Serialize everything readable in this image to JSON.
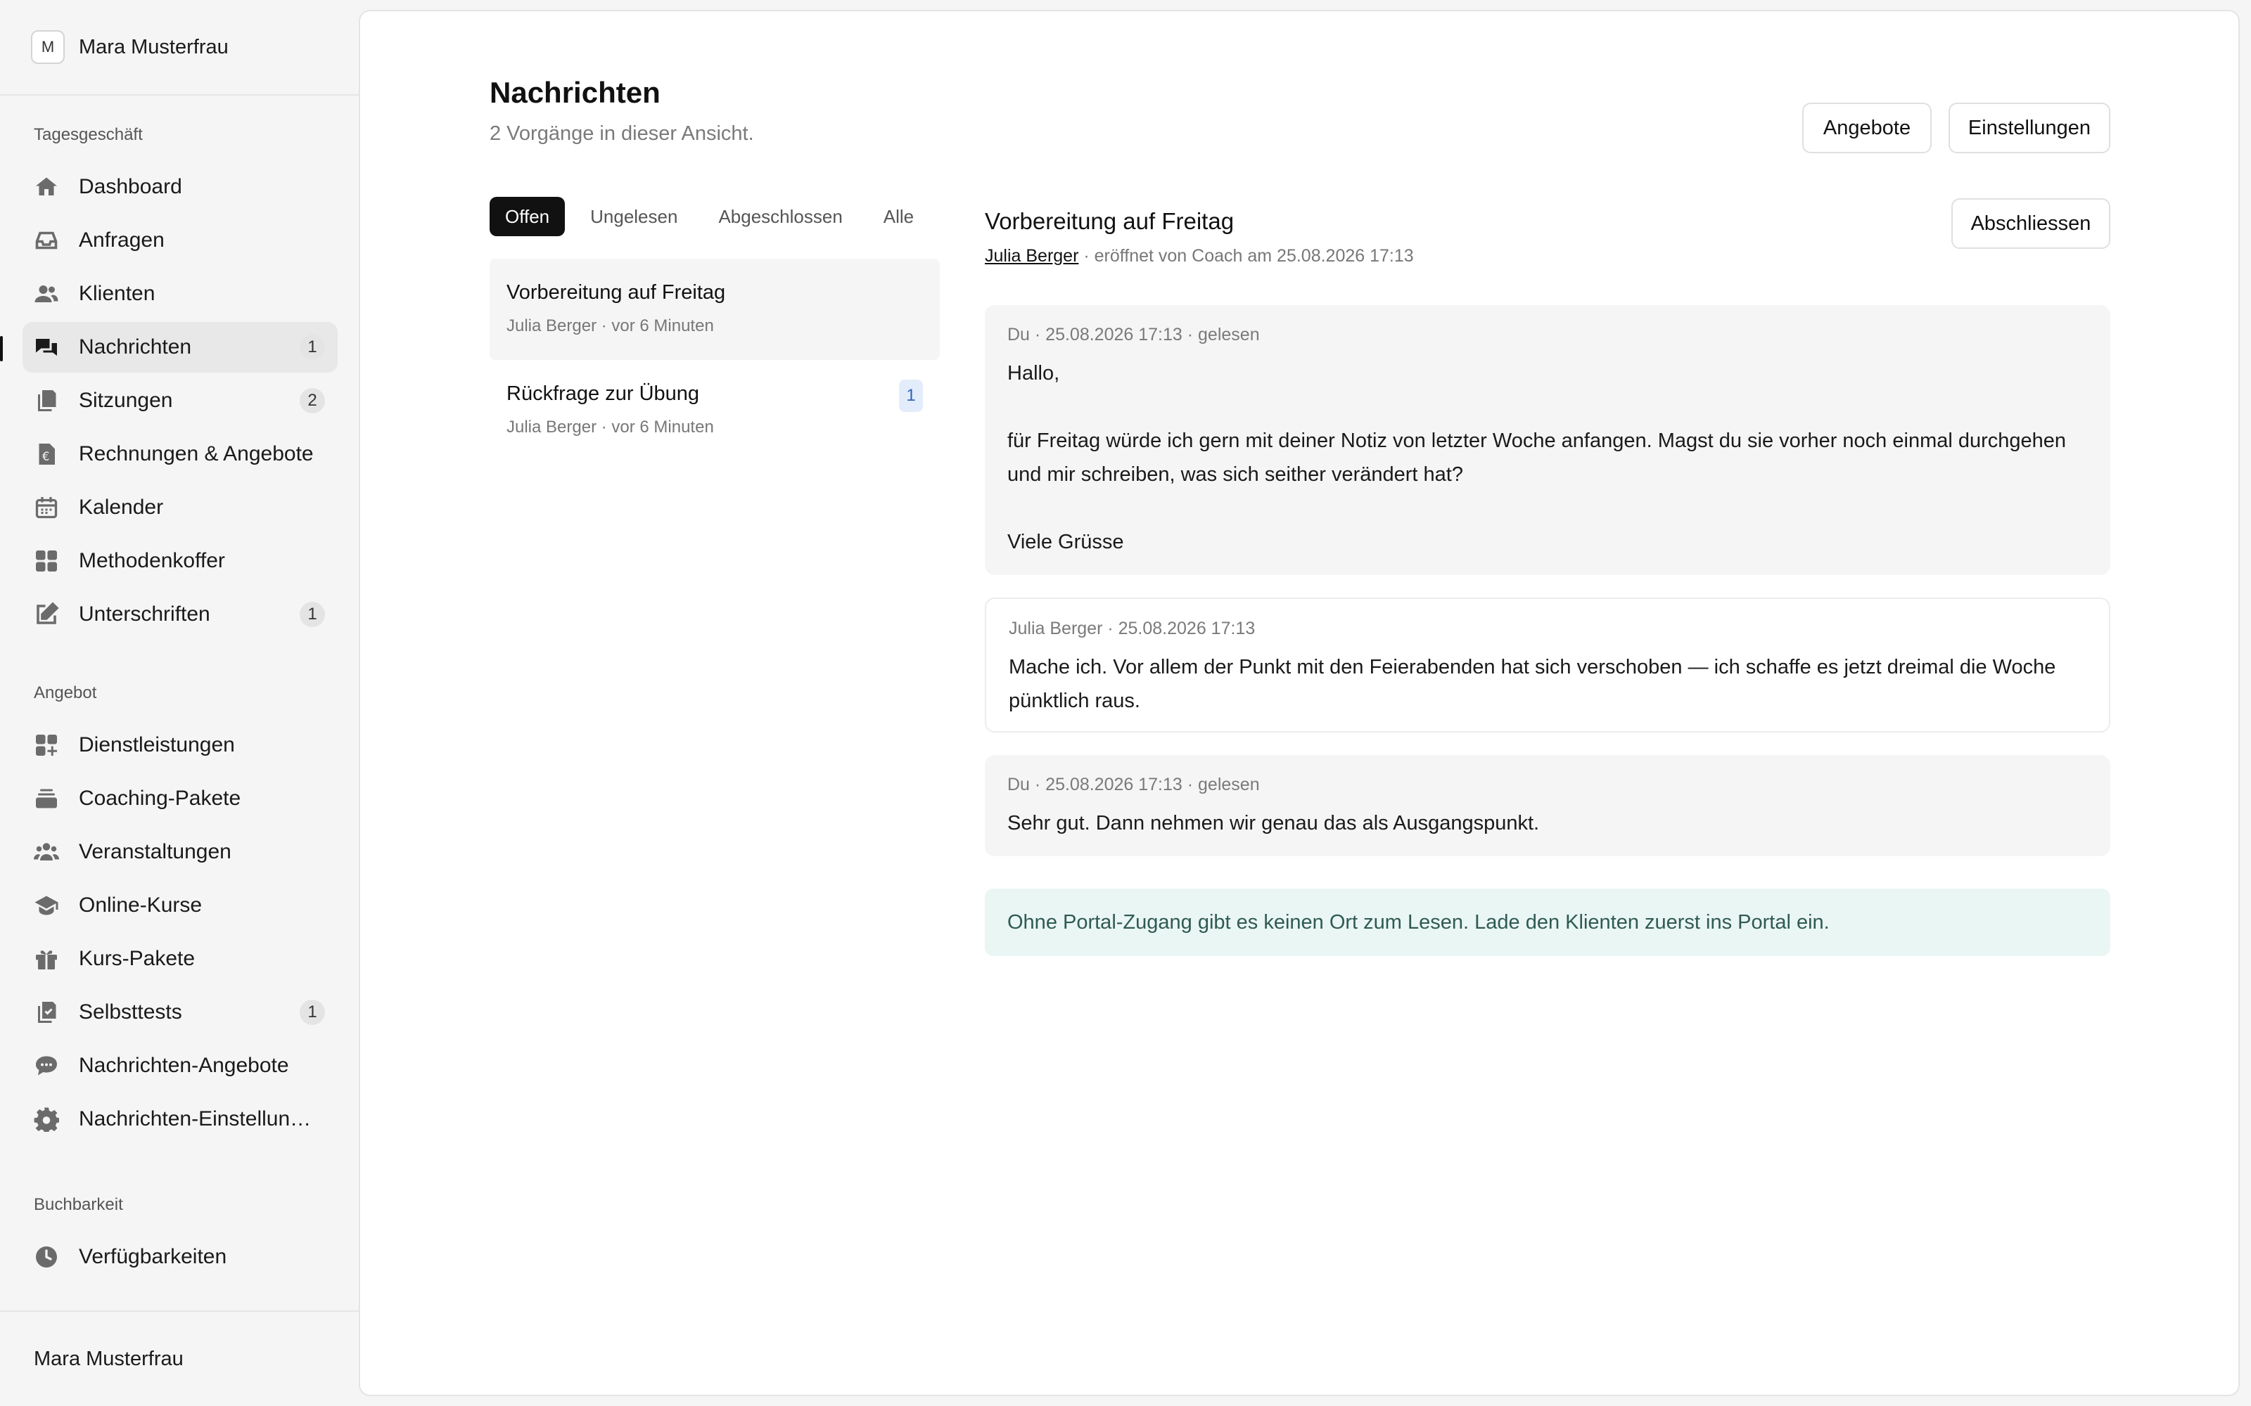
{
  "sidebar": {
    "user": {
      "initial": "M",
      "name": "Mara Musterfrau"
    },
    "sections": {
      "daily": "Tagesgeschäft",
      "offer": "Angebot",
      "booking": "Buchbarkeit"
    },
    "items": [
      {
        "label": "Dashboard",
        "icon": "home-icon"
      },
      {
        "label": "Anfragen",
        "icon": "inbox-icon"
      },
      {
        "label": "Klienten",
        "icon": "users-icon"
      },
      {
        "label": "Nachrichten",
        "icon": "chat-bubbles-icon",
        "badge": "1",
        "active": true
      },
      {
        "label": "Sitzungen",
        "icon": "documents-icon",
        "badge": "2"
      },
      {
        "label": "Rechnungen & Angebote",
        "icon": "euro-document-icon"
      },
      {
        "label": "Kalender",
        "icon": "calendar-icon"
      },
      {
        "label": "Methodenkoffer",
        "icon": "grid-icon"
      },
      {
        "label": "Unterschriften",
        "icon": "pencil-square-icon",
        "badge": "1"
      },
      {
        "label": "Dienstleistungen",
        "icon": "grid-plus-icon"
      },
      {
        "label": "Coaching-Pakete",
        "icon": "stack-icon"
      },
      {
        "label": "Veranstaltungen",
        "icon": "group-icon"
      },
      {
        "label": "Online-Kurse",
        "icon": "graduation-cap-icon"
      },
      {
        "label": "Kurs-Pakete",
        "icon": "gift-icon"
      },
      {
        "label": "Selbsttests",
        "icon": "checklist-icon",
        "badge": "1"
      },
      {
        "label": "Nachrichten-Angebote",
        "icon": "speech-bubble-icon"
      },
      {
        "label": "Nachrichten-Einstellung…",
        "icon": "gear-icon"
      },
      {
        "label": "Verfügbarkeiten",
        "icon": "clock-icon"
      }
    ],
    "footer_name": "Mara Musterfrau"
  },
  "header": {
    "title": "Nachrichten",
    "subtitle": "2 Vorgänge in dieser Ansicht.",
    "btn_offers": "Angebote",
    "btn_settings": "Einstellungen"
  },
  "tabs": [
    "Offen",
    "Ungelesen",
    "Abgeschlossen",
    "Alle"
  ],
  "threads": [
    {
      "title": "Vorbereitung auf Freitag",
      "meta": "Julia Berger · vor 6 Minuten"
    },
    {
      "title": "Rückfrage zur Übung",
      "meta": "Julia Berger · vor 6 Minuten",
      "badge": "1"
    }
  ],
  "conversation": {
    "title": "Vorbereitung auf Freitag",
    "author": "Julia Berger",
    "meta_rest": " · eröffnet von Coach am 25.08.2026 17:13",
    "close_button": "Abschliessen",
    "messages": [
      {
        "meta": "Du · 25.08.2026 17:13 · gelesen",
        "body": "Hallo,\n\nfür Freitag würde ich gern mit deiner Notiz von letzter Woche anfangen. Magst du sie vorher noch einmal durchgehen und mir schreiben, was sich seither verändert hat?\n\nViele Grüsse"
      },
      {
        "meta": "Julia Berger · 25.08.2026 17:13",
        "body": "Mache ich. Vor allem der Punkt mit den Feierabenden hat sich verschoben — ich schaffe es jetzt dreimal die Woche pünktlich raus."
      },
      {
        "meta": "Du · 25.08.2026 17:13 · gelesen",
        "body": "Sehr gut. Dann nehmen wir genau das als Ausgangspunkt."
      }
    ],
    "notice": "Ohne Portal-Zugang gibt es keinen Ort zum Lesen. Lade den Klienten zuerst ins Portal ein."
  },
  "colors": {
    "accent": "#111111",
    "notice_bg": "#eaf6f4",
    "badge_blue": "#3160b8"
  }
}
